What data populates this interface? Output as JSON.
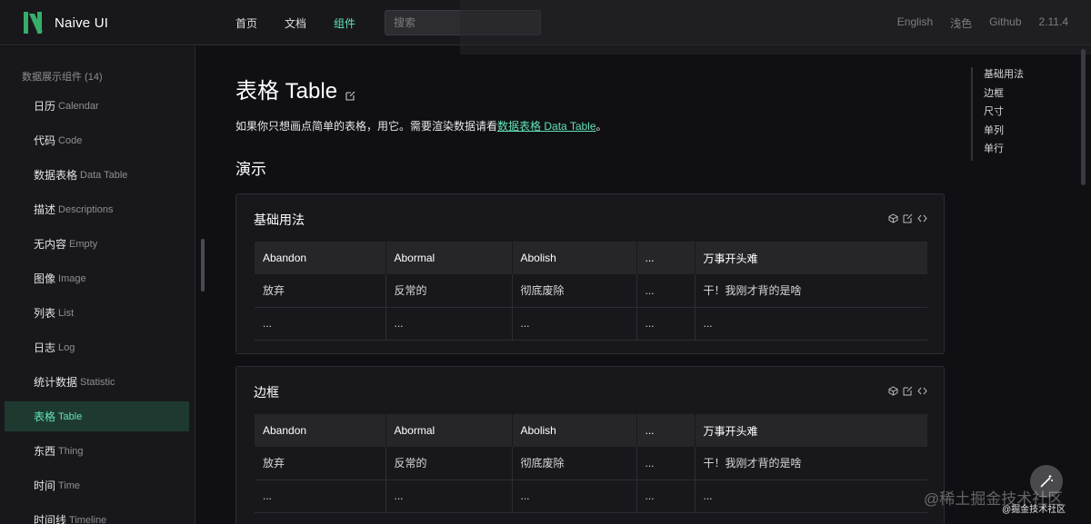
{
  "header": {
    "logo_text": "Naive UI",
    "nav": [
      "首页",
      "文档",
      "组件"
    ],
    "active_nav": "组件",
    "search_placeholder": "搜索",
    "right": {
      "language": "English",
      "theme": "浅色",
      "github": "Github",
      "version": "2.11.4"
    }
  },
  "sidebar": {
    "group_title": "数据展示组件 (14)",
    "items": [
      {
        "zh": "日历",
        "en": "Calendar"
      },
      {
        "zh": "代码",
        "en": "Code"
      },
      {
        "zh": "数据表格",
        "en": "Data Table"
      },
      {
        "zh": "描述",
        "en": "Descriptions"
      },
      {
        "zh": "无内容",
        "en": "Empty"
      },
      {
        "zh": "图像",
        "en": "Image"
      },
      {
        "zh": "列表",
        "en": "List"
      },
      {
        "zh": "日志",
        "en": "Log"
      },
      {
        "zh": "统计数据",
        "en": "Statistic"
      },
      {
        "zh": "表格",
        "en": "Table"
      },
      {
        "zh": "东西",
        "en": "Thing"
      },
      {
        "zh": "时间",
        "en": "Time"
      },
      {
        "zh": "时间线",
        "en": "Timeline"
      }
    ],
    "active_item": "Table"
  },
  "main": {
    "title": "表格 Table",
    "intro_prefix": "如果你只想画点简单的表格，用它。需要渲染数据请看",
    "intro_link": "数据表格 Data Table",
    "intro_suffix": "。",
    "section_title": "演示",
    "cards": [
      {
        "title": "基础用法",
        "headers": [
          "Abandon",
          "Abormal",
          "Abolish",
          "...",
          "万事开头难"
        ],
        "rows": [
          [
            "放弃",
            "反常的",
            "彻底废除",
            "...",
            "干！我刚才背的是啥"
          ],
          [
            "...",
            "...",
            "...",
            "...",
            "..."
          ]
        ]
      },
      {
        "title": "边框",
        "headers": [
          "Abandon",
          "Abormal",
          "Abolish",
          "...",
          "万事开头难"
        ],
        "rows": [
          [
            "放弃",
            "反常的",
            "彻底废除",
            "...",
            "干！我刚才背的是啥"
          ],
          [
            "...",
            "...",
            "...",
            "...",
            "..."
          ]
        ]
      }
    ]
  },
  "anchors": [
    "基础用法",
    "边框",
    "尺寸",
    "单列",
    "单行"
  ],
  "watermark": {
    "main": "@稀土掘金技术社区",
    "corner": "@掘金技术社区"
  },
  "colors": {
    "accent": "#63e2b7",
    "brand": "#36ad6a",
    "background": "#101014",
    "surface": "#18181c"
  }
}
